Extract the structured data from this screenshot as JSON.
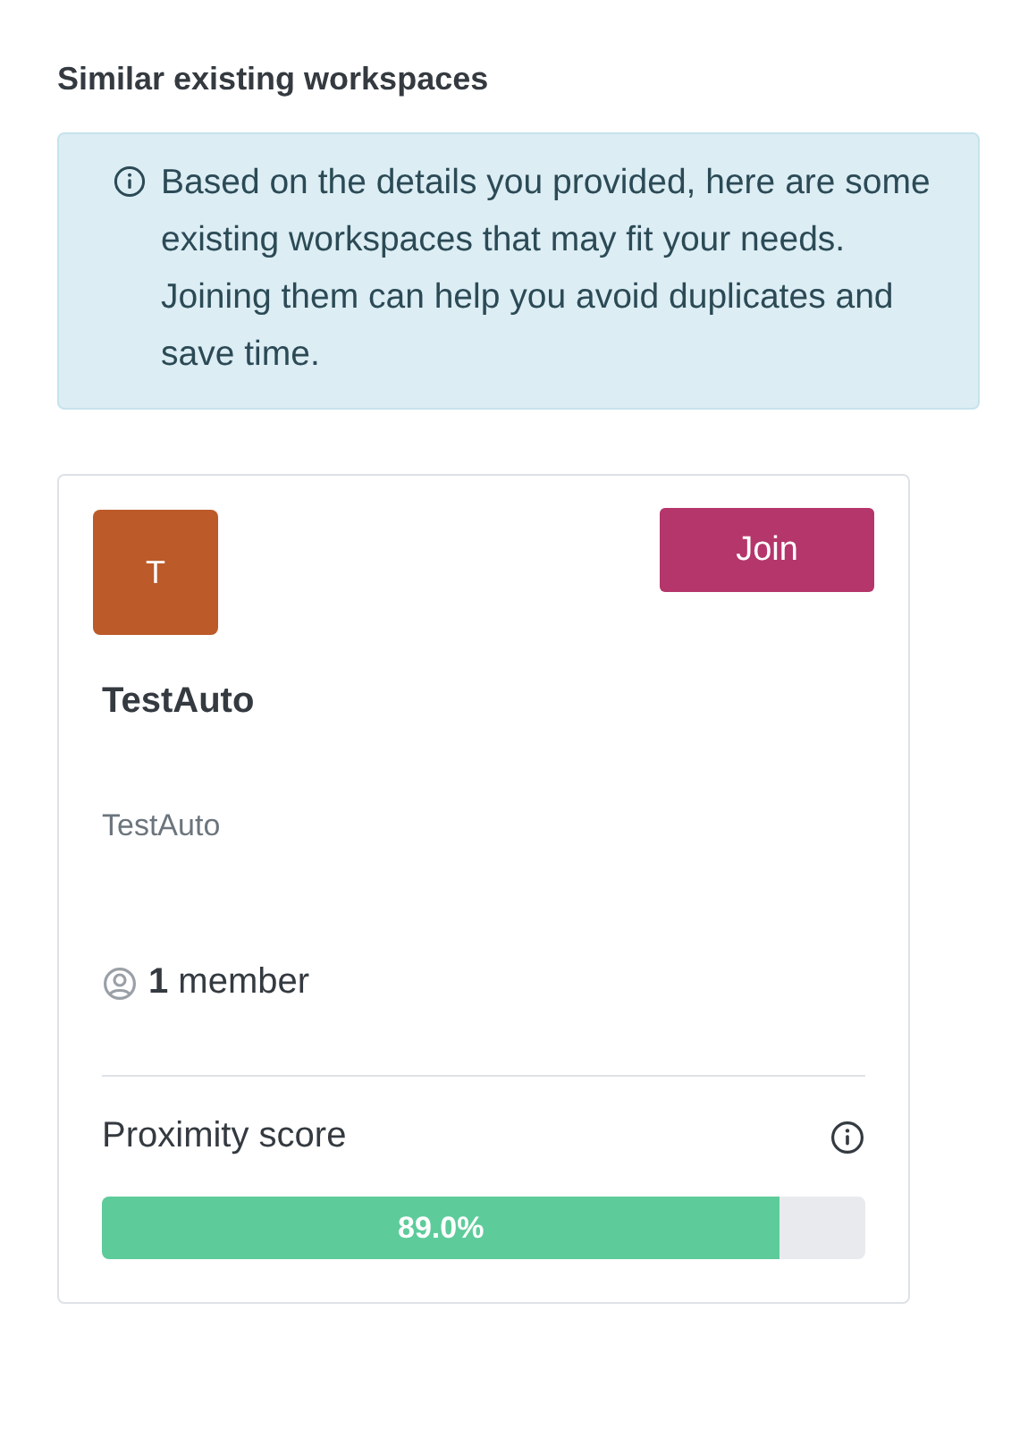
{
  "section_title": "Similar existing workspaces",
  "info_note": "Based on the details you provided, here are some existing workspaces that may fit your needs. Joining them can help you avoid duplicates and save time.",
  "workspaces": [
    {
      "initial": "T",
      "color": "#bc5a2a",
      "join_label": "Join",
      "name": "TestAuto",
      "description": "TestAuto",
      "members": "**1** member",
      "proximity_label": "Proximity score",
      "level": 0.888,
      "score": "89.0%"
    }
  ]
}
